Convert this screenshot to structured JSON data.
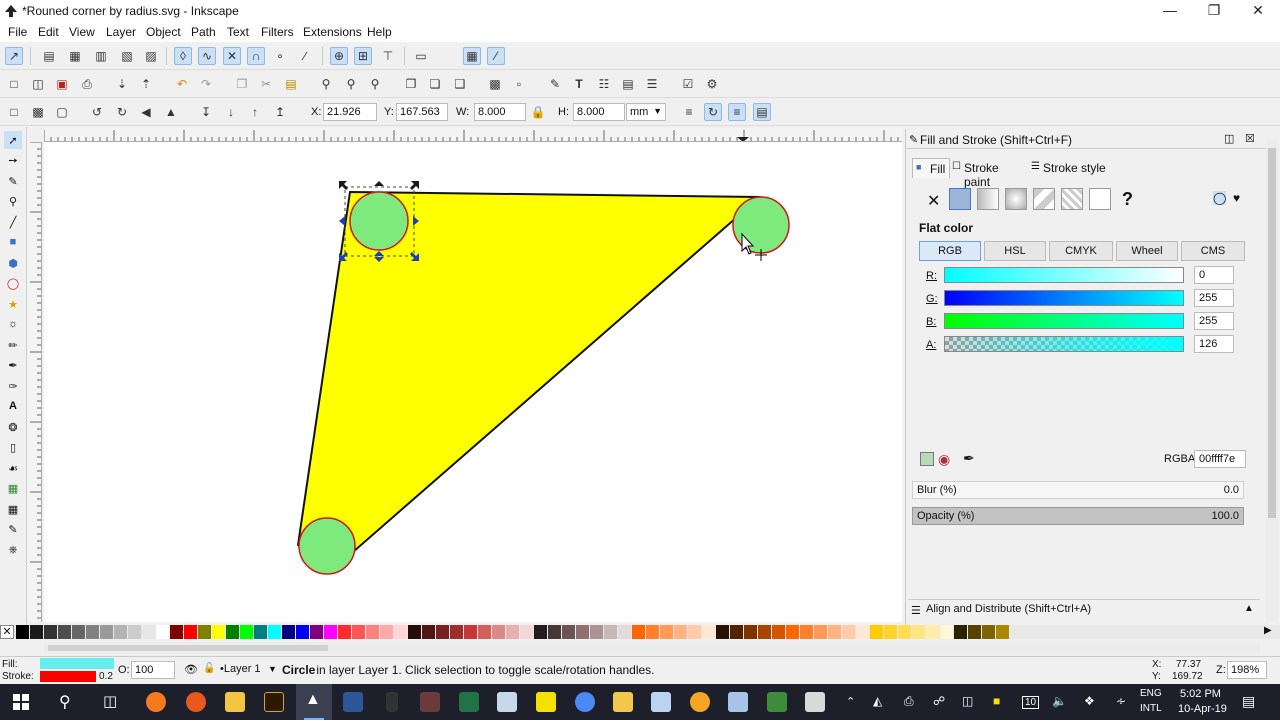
{
  "window": {
    "title": "*Rouned corner by radius.svg - Inkscape"
  },
  "menu": [
    "File",
    "Edit",
    "View",
    "Layer",
    "Object",
    "Path",
    "Text",
    "Filters",
    "Extensions",
    "Help"
  ],
  "toolcontrols": {
    "x_label": "X:",
    "x_value": "21.926",
    "y_label": "Y:",
    "y_value": "167.563",
    "w_label": "W:",
    "w_value": "8.000",
    "h_label": "H:",
    "h_value": "8.000",
    "unit": "mm"
  },
  "fill_stroke": {
    "title": "Fill and Stroke (Shift+Ctrl+F)",
    "tabs": [
      "Fill",
      "Stroke paint",
      "Stroke style"
    ],
    "paint_mode_label": "Flat color",
    "color_tabs": [
      "RGB",
      "HSL",
      "CMYK",
      "Wheel",
      "CMS"
    ],
    "channels": [
      {
        "label": "R:",
        "value": "0"
      },
      {
        "label": "G:",
        "value": "255"
      },
      {
        "label": "B:",
        "value": "255"
      },
      {
        "label": "A:",
        "value": "126"
      }
    ],
    "rgba_label": "RGBA:",
    "rgba_value": "00ffff7e",
    "blur_label": "Blur (%)",
    "blur_value": "0.0",
    "opacity_label": "Opacity (%)",
    "opacity_value": "100.0",
    "unknown_paint": "?"
  },
  "align_panel": {
    "title": "Align and Distribute (Shift+Ctrl+A)"
  },
  "status": {
    "fill_label": "Fill:",
    "stroke_label": "Stroke:",
    "stroke_width": "0.2",
    "opacity_label": "O:",
    "opacity_value": "100",
    "layer": "•Layer 1",
    "message_bold": "Circle",
    "message": " in layer Layer 1. Click selection to toggle scale/rotation handles.",
    "cursor_x_label": "X:",
    "cursor_x": "77.37",
    "cursor_y_label": "Y:",
    "cursor_y": "169.72",
    "zoom_label": "Z:",
    "zoom": "198%"
  },
  "taskbar": {
    "lang_top": "ENG",
    "lang_bottom": "INTL",
    "time": "5:02 PM",
    "date": "10-Apr-19",
    "notif_count": "10"
  },
  "colors": {
    "triangle_fill": "#ffff00",
    "circle_fill": "#7eea7e",
    "circle_stroke": "#d01818",
    "status_fill": "#66eeee",
    "status_stroke": "#ff0000",
    "taskbar": "#1d1f2b"
  },
  "palette": [
    "#000000",
    "#1a1a1a",
    "#333333",
    "#4d4d4d",
    "#666666",
    "#808080",
    "#999999",
    "#b3b3b3",
    "#cccccc",
    "#e6e6e6",
    "#ffffff",
    "#800000",
    "#ff0000",
    "#808000",
    "#ffff00",
    "#008000",
    "#00ff00",
    "#008080",
    "#00ffff",
    "#000080",
    "#0000ff",
    "#800080",
    "#ff00ff",
    "#ff2a2a",
    "#ff5555",
    "#ff8080",
    "#ffaaaa",
    "#ffd5d5",
    "#280b0b",
    "#501616",
    "#782121",
    "#a02c2c",
    "#c83737",
    "#d35f5f",
    "#de8787",
    "#e9afaf",
    "#f4d7d7",
    "#241c1c",
    "#483737",
    "#6c5353",
    "#916f6f",
    "#ac9393",
    "#c8b7b7",
    "#e3dbdb",
    "#ff6600",
    "#ff7f2a",
    "#ff9955",
    "#ffb380",
    "#ffccaa",
    "#ffe6d5",
    "#2b1100",
    "#552200",
    "#803300",
    "#aa4400",
    "#d45500",
    "#ff6600",
    "#ff7f2a",
    "#ff9955",
    "#ffb380",
    "#ffccaa",
    "#ffe6d5",
    "#ffcc00",
    "#ffd42a",
    "#ffdd55",
    "#ffe680",
    "#ffeeaa",
    "#fff6d5",
    "#2b2200",
    "#554400",
    "#806600",
    "#aa8800"
  ]
}
